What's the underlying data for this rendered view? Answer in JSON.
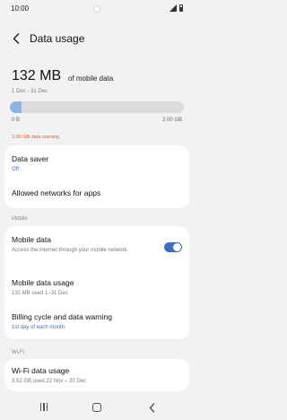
{
  "status_bar": {
    "time": "10:00"
  },
  "header": {
    "title": "Data usage"
  },
  "usage": {
    "amount": "132 MB",
    "suffix": "of mobile data",
    "period": "1 Dec - 31 Dec",
    "bar_fill_fraction": 0.066,
    "axis_min": "0 B",
    "axis_max": "2.00 GB",
    "warning": "2.00 GB data warning"
  },
  "colors": {
    "accent": "#3e6dc6",
    "warning": "#e8641e",
    "bar_fill": "#8fb4e2"
  },
  "settings": {
    "data_saver": {
      "title": "Data saver",
      "value": "Off"
    },
    "allowed_networks": {
      "title": "Allowed networks for apps"
    }
  },
  "mobile": {
    "section_label": "Mobile",
    "mobile_data": {
      "title": "Mobile data",
      "description": "Access the internet through your mobile network.",
      "enabled": true
    },
    "mobile_data_usage": {
      "title": "Mobile data usage",
      "value": "132 MB used 1–31 Dec"
    },
    "billing_cycle": {
      "title": "Billing cycle and data warning",
      "value": "1st day of each month"
    }
  },
  "wifi": {
    "section_label": "Wi-Fi",
    "wifi_data_usage": {
      "title": "Wi-Fi data usage",
      "value": "3.52 GB used 22 Nov – 20 Dec"
    }
  },
  "icons": {
    "back": "chevron-left-icon",
    "signal": "signal-icon",
    "battery": "battery-icon",
    "nav_recent": "recent-apps-icon",
    "nav_home": "home-icon",
    "nav_back": "back-icon"
  }
}
